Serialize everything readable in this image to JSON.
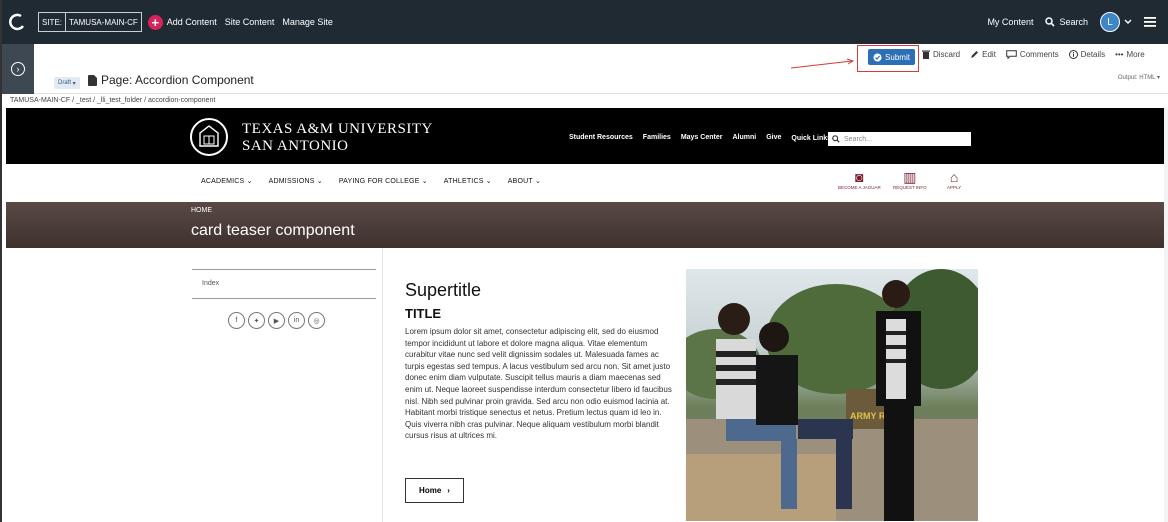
{
  "topbar": {
    "site_prefix": "SITE:",
    "site_name": "TAMUSA-MAIN-CF",
    "add_content": "Add Content",
    "site_content": "Site Content",
    "manage_site": "Manage Site",
    "my_content": "My Content",
    "search": "Search",
    "avatar_initial": "L"
  },
  "pagebar": {
    "draft_label": "Draft",
    "page_title": "Page: Accordion Component",
    "submit": "Submit",
    "discard": "Discard",
    "edit": "Edit",
    "comments": "Comments",
    "details": "Details",
    "more": "More",
    "output": "Output: HTML"
  },
  "breadcrumb": "TAMUSA-MAIN-CF / _test / _lli_test_folder / accordion-component",
  "site": {
    "name_line1": "TEXAS A&M UNIVERSITY",
    "name_line2": "SAN ANTONIO",
    "utility_links": [
      "Student Resources",
      "Families",
      "Mays Center",
      "Alumni",
      "Give",
      "Quick Links"
    ],
    "search_placeholder": "Search...",
    "main_nav": [
      "ACADEMICS",
      "ADMISSIONS",
      "PAYING FOR COLLEGE",
      "ATHLETICS",
      "ABOUT"
    ],
    "quick_actions": [
      "BECOME A JAGUAR",
      "REQUEST INFO",
      "APPLY"
    ],
    "hero_crumb": "HOME",
    "hero_title": "card teaser component",
    "side_nav_item": "Index",
    "supertitle": "Supertitle",
    "title": "TITLE",
    "body": "Lorem ipsum dolor sit amet, consectetur adipiscing elit, sed do eiusmod tempor incididunt ut labore et dolore magna aliqua. Vitae elementum curabitur vitae nunc sed velit dignissim sodales ut. Malesuada fames ac turpis egestas sed tempus. A lacus vestibulum sed arcu non. Sit amet justo donec enim diam vulputate. Suscipit tellus mauris a diam maecenas sed enim ut. Neque laoreet suspendisse interdum consectetur libero id faucibus nisl. Nibh sed pulvinar proin gravida. Sed arcu non odio euismod lacinia at. Habitant morbi tristique senectus et netus. Pretium lectus quam id leo in. Quis viverra nibh cras pulvinar. Neque aliquam vestibulum morbi blandit cursus risus at ultrices mi.",
    "button": "Home",
    "photo_sign": "ARMY ROTC"
  },
  "colors": {
    "cms_dark": "#1f2a33",
    "accent_blue": "#2c6fb6",
    "highlight_red": "#d63a3a",
    "maroon": "#7a1e2d"
  }
}
